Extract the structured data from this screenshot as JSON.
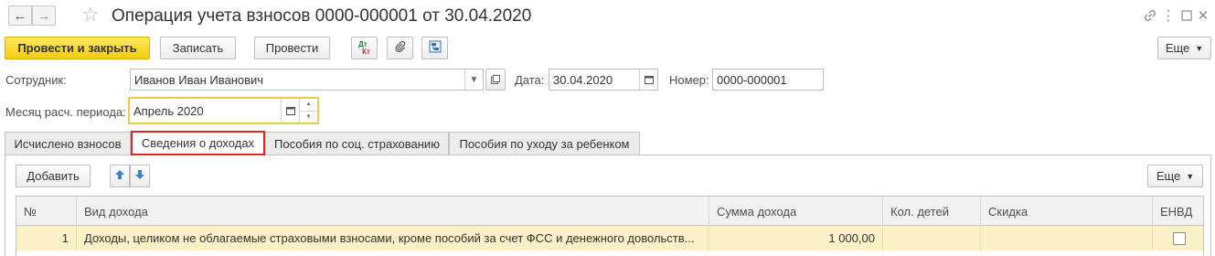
{
  "window": {
    "title": "Операция учета взносов 0000-000001 от 30.04.2020",
    "back_icon": "arrow-left-icon",
    "forward_icon": "arrow-right-icon",
    "favorite_icon": "star-icon",
    "link_icon": "link-icon",
    "menu_icon": "more-vertical-icon",
    "maximize_icon": "maximize-icon",
    "close_icon": "close-icon"
  },
  "toolbar": {
    "post_and_close_label": "Провести и закрыть",
    "save_label": "Записать",
    "post_label": "Провести",
    "dtkt_top": "Дт",
    "dtkt_bottom": "Кт",
    "more_label": "Еще"
  },
  "form": {
    "employee_label": "Сотрудник:",
    "employee_value": "Иванов Иван Иванович",
    "date_label": "Дата:",
    "date_value": "30.04.2020",
    "number_label": "Номер:",
    "number_value": "0000-000001",
    "period_label": "Месяц расч. периода:",
    "period_value": "Апрель 2020"
  },
  "tabs": [
    {
      "label": "Исчислено взносов",
      "active": false
    },
    {
      "label": "Сведения о доходах",
      "active": true
    },
    {
      "label": "Пособия по соц. страхованию",
      "active": false
    },
    {
      "label": "Пособия по уходу за ребенком",
      "active": false
    }
  ],
  "table_toolbar": {
    "add_label": "Добавить",
    "more_label": "Еще"
  },
  "table": {
    "columns": [
      "№",
      "Вид дохода",
      "Сумма дохода",
      "Кол. детей",
      "Скидка",
      "ЕНВД"
    ],
    "rows": [
      {
        "num": "1",
        "income_type": "Доходы, целиком не облагаемые страховыми взносами, кроме пособий за счет ФСС и денежного довольств...",
        "amount": "1 000,00",
        "children": "",
        "discount": "",
        "envd": false
      }
    ]
  },
  "colors": {
    "primary_button": "#f4cd10",
    "active_tab_border": "#e0242c",
    "focused_field_border": "#f2c94c",
    "selected_row": "#fbf1c7"
  }
}
